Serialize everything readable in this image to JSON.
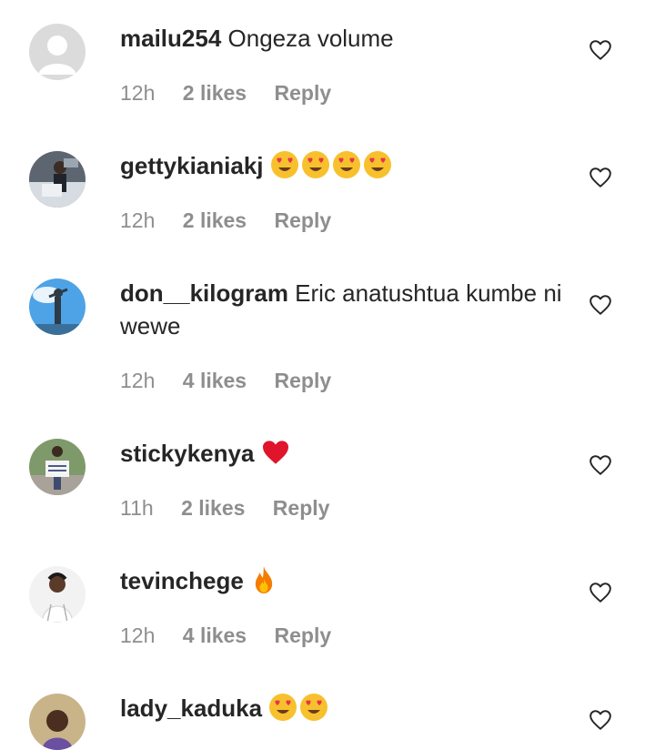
{
  "comments": [
    {
      "username": "mailu254",
      "text": "Ongeza volume",
      "time": "12h",
      "likes": "2 likes",
      "reply": "Reply",
      "emojis": [],
      "avatar": "default-avatar"
    },
    {
      "username": "gettykianiakj",
      "text": "",
      "time": "12h",
      "likes": "2 likes",
      "reply": "Reply",
      "emojis": [
        "heart-eyes-emoji",
        "heart-eyes-emoji",
        "heart-eyes-emoji",
        "heart-eyes-emoji"
      ],
      "avatar": "photo"
    },
    {
      "username": "don__kilogram",
      "text": "Eric anatushtua kumbe ni wewe",
      "time": "12h",
      "likes": "4 likes",
      "reply": "Reply",
      "emojis": [],
      "avatar": "photo"
    },
    {
      "username": "stickykenya",
      "text": "",
      "time": "11h",
      "likes": "2 likes",
      "reply": "Reply",
      "emojis": [
        "red-heart-emoji"
      ],
      "avatar": "photo"
    },
    {
      "username": "tevinchege",
      "text": "",
      "time": "12h",
      "likes": "4 likes",
      "reply": "Reply",
      "emojis": [
        "fire-emoji"
      ],
      "avatar": "photo"
    },
    {
      "username": "lady_kaduka",
      "text": "",
      "time": "",
      "likes": "",
      "reply": "",
      "emojis": [
        "heart-eyes-emoji",
        "heart-eyes-emoji"
      ],
      "avatar": "photo"
    }
  ],
  "icons": {
    "like": "heart-outline-icon"
  },
  "colors": {
    "text": "#262626",
    "meta": "#8e8e8e",
    "emoji_face": "#f7c12e",
    "emoji_heart": "#e8334a",
    "heart_red": "#e0142a",
    "fire": "#f57c00"
  }
}
